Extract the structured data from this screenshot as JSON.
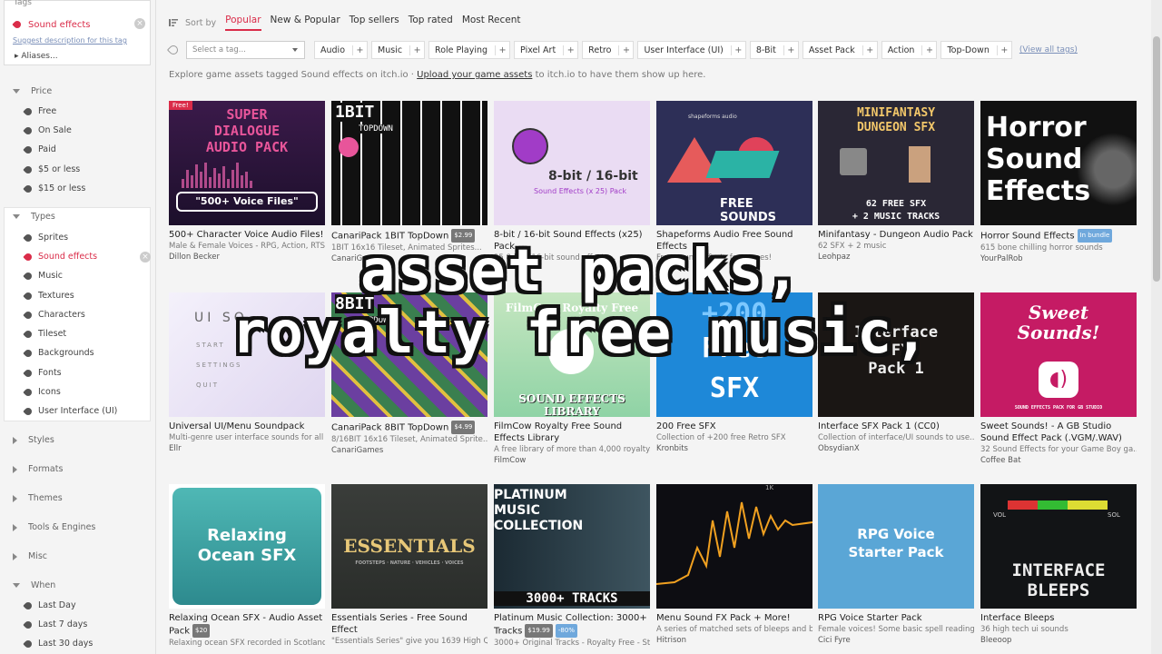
{
  "sidebar": {
    "tags_label": "Tags",
    "current_tag": "Sound effects",
    "suggest_link": "Suggest description for this tag",
    "aliases": "Aliases...",
    "price": {
      "heading": "Price",
      "items": [
        "Free",
        "On Sale",
        "Paid",
        "$5 or less",
        "$15 or less"
      ]
    },
    "types": {
      "heading": "Types",
      "items": [
        "Sprites",
        "Sound effects",
        "Music",
        "Textures",
        "Characters",
        "Tileset",
        "Backgrounds",
        "Fonts",
        "Icons",
        "User Interface (UI)"
      ]
    },
    "collapsed": [
      "Styles",
      "Formats",
      "Themes",
      "Tools & Engines",
      "Misc"
    ],
    "when": {
      "heading": "When",
      "items": [
        "Last Day",
        "Last 7 days",
        "Last 30 days"
      ]
    }
  },
  "sort": {
    "label": "Sort by",
    "tabs": [
      "Popular",
      "New & Popular",
      "Top sellers",
      "Top rated",
      "Most Recent"
    ]
  },
  "tagbar": {
    "select_placeholder": "Select a tag...",
    "tags": [
      "Audio",
      "Music",
      "Role Playing",
      "Pixel Art",
      "Retro",
      "User Interface (UI)",
      "8-Bit",
      "Asset Pack",
      "Action",
      "Top-Down"
    ],
    "view_all": "(View all tags)"
  },
  "explore": {
    "prefix": "Explore game assets tagged Sound effects on itch.io · ",
    "link": "Upload your game assets",
    "suffix": " to itch.io to have them show up here."
  },
  "caption": {
    "line1": "asset packs,",
    "line2": "royalty free music,"
  },
  "cards": [
    {
      "title": "500+ Character Voice Audio Files!",
      "desc": "Male & Female Voices - RPG, Action, RTS...",
      "author": "Dillon Becker",
      "ribbon": "Free!",
      "thumb_l1": "SUPER",
      "thumb_l2": "DIALOGUE",
      "thumb_l3": "AUDIO PACK",
      "thumb_l4": "\"500+ Voice Files\""
    },
    {
      "title": "CanariPack 1BIT TopDown",
      "price": "$2.99",
      "desc": "1BIT 16x16 Tileset, Animated Sprites...",
      "author": "CanariGames",
      "thumb_l1": "1BIT",
      "thumb_l2": "TOPDOWN"
    },
    {
      "title": "8-bit / 16-bit Sound Effects (x25) Pack",
      "desc": "25 8-bit / 16-bit sound effects...",
      "author": "",
      "thumb_l1": "8-bit / 16-bit",
      "thumb_l2": "Sound Effects (x 25) Pack"
    },
    {
      "title": "Shapeforms Audio Free Sound Effects",
      "desc": "Free sound effects for games!",
      "author": "",
      "thumb_l1": "shapeforms audio",
      "thumb_l2": "FREE SOUNDS"
    },
    {
      "title": "Minifantasy - Dungeon Audio Pack",
      "desc": "62 SFX + 2 music",
      "author": "Leohpaz",
      "thumb_l1": "MINIFANTASY",
      "thumb_l2": "DUNGEON SFX",
      "thumb_l3": "62 FREE SFX",
      "thumb_l4": "+ 2 MUSIC TRACKS"
    },
    {
      "title": "Horror Sound Effects",
      "badge": "In bundle",
      "desc": "615 bone chilling horror sounds",
      "author": "YourPalRob",
      "thumb_l1": "Horror",
      "thumb_l2": "Sound",
      "thumb_l3": "Effects"
    },
    {
      "title": "Universal UI/Menu Soundpack",
      "desc": "Multi-genre user interface sounds for all ...",
      "author": "Ellr",
      "thumb_l1": "UI SO",
      "thumb_l2": "START",
      "thumb_l3": "SETTINGS",
      "thumb_l4": "QUIT"
    },
    {
      "title": "CanariPack 8BIT TopDown",
      "price": "$4.99",
      "desc": "8/16BIT 16x16 Tileset, Animated Sprite...",
      "author": "CanariGames",
      "thumb_l1": "8BIT",
      "thumb_l2": "TOPDOWN"
    },
    {
      "title": "FilmCow Royalty Free Sound Effects Library",
      "desc": "A free library of more than 4,000 royalty...",
      "author": "FilmCow",
      "thumb_l1": "FilmCow Royalty Free",
      "thumb_l2": "SOUND EFFECTS LIBRARY"
    },
    {
      "title": "200 Free SFX",
      "desc": "Collection of +200 free Retro SFX",
      "author": "Kronbits",
      "thumb_l1": "+200",
      "thumb_l2": "Free",
      "thumb_l3": "SFX"
    },
    {
      "title": "Interface SFX Pack 1 (CC0)",
      "desc": "Collection of interface/UI sounds to use...",
      "author": "ObsydianX",
      "thumb_l1": "Interface",
      "thumb_l2": "SFX",
      "thumb_l3": "Pack 1"
    },
    {
      "title": "Sweet Sounds! - A GB Studio Sound Effect Pack (.VGM/.WAV)",
      "desc": "32 Sound Effects for your Game Boy ga...",
      "author": "Coffee Bat",
      "thumb_l1": "Sweet",
      "thumb_l2": "Sounds!",
      "thumb_l3": "SOUND EFFECTS PACK FOR GB STUDIO"
    },
    {
      "title": "Relaxing Ocean SFX - Audio Asset Pack",
      "price": "$20",
      "desc": "Relaxing ocean SFX recorded in Scotland...",
      "author": "",
      "thumb_l1": "Relaxing",
      "thumb_l2": "Ocean SFX"
    },
    {
      "title": "Essentials Series - Free Sound Effect",
      "desc": "\"Essentials Series\" give you 1639 High Q...",
      "author": "",
      "thumb_l1": "ESSENTIALS",
      "thumb_l2": "FOOTSTEPS · NATURE · VEHICLES · VOICES"
    },
    {
      "title": "Platinum Music Collection: 3000+ Tracks",
      "price": "$19.99",
      "badge": "-80%",
      "desc": "3000+ Original Tracks - Royalty Free - St...",
      "author": "",
      "thumb_l1": "PLATINUM",
      "thumb_l2": "MUSIC",
      "thumb_l3": "COLLECTION",
      "thumb_l4": "3000+ TRACKS"
    },
    {
      "title": "Menu Sound FX Pack + More!",
      "desc": "A series of matched sets of bleeps and bl...",
      "author": "Hitrison",
      "thumb_l1": "1K"
    },
    {
      "title": "RPG Voice Starter Pack",
      "desc": "Female voices! Some basic spell readings...",
      "author": "Cici Fyre",
      "thumb_l1": "RPG Voice",
      "thumb_l2": "Starter Pack"
    },
    {
      "title": "Interface Bleeps",
      "desc": "36 high tech ui sounds",
      "author": "Bleeoop",
      "thumb_l1": "INTERFACE",
      "thumb_l2": "BLEEPS",
      "thumb_l3": "VOL",
      "thumb_l4": "SOL"
    }
  ],
  "colors": {
    "accent": "#da2c49",
    "link": "#7a8fb8"
  }
}
